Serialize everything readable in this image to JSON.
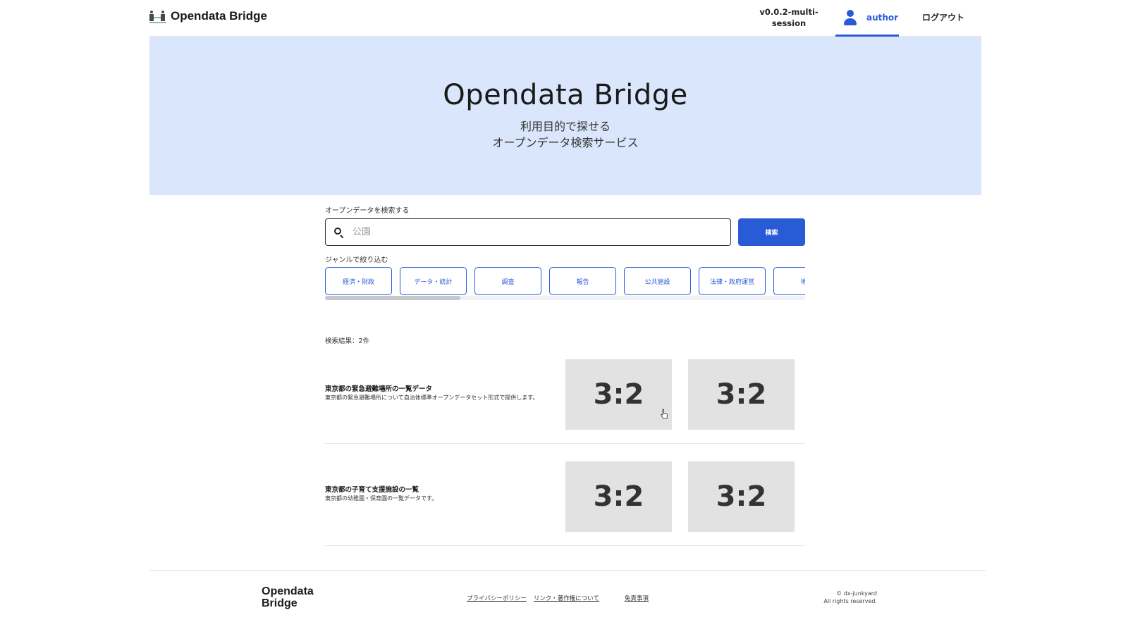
{
  "header": {
    "brand": "Opendata Bridge",
    "version_line1": "v0.0.2-multi-",
    "version_line2": "session",
    "user_name": "author",
    "logout_label": "ログアウト"
  },
  "hero": {
    "title": "Opendata Bridge",
    "subtitle_line1": "利用目的で探せる",
    "subtitle_line2": "オープンデータ検索サービス"
  },
  "search": {
    "label": "オープンデータを検索する",
    "placeholder": "公園",
    "value": "",
    "button_label": "検索"
  },
  "genre": {
    "label": "ジャンルで絞り込む",
    "chips": [
      "経済・財政",
      "データ・統計",
      "調査",
      "報告",
      "公共施設",
      "法律・政府運営",
      "地域"
    ]
  },
  "results": {
    "count_label": "検索結果：2件",
    "items": [
      {
        "title": "東京都の緊急避難場所の一覧データ",
        "description": "東京都の緊急避難場所について自治体標準オープンデータセット形式で提供します。",
        "thumb1": "3:2",
        "thumb2": "3:2"
      },
      {
        "title": "東京都の子育て支援施設の一覧",
        "description": "東京都の幼稚園・保育園の一覧データです。",
        "thumb1": "3:2",
        "thumb2": "3:2"
      }
    ]
  },
  "footer": {
    "brand_line1": "Opendata",
    "brand_line2": "Bridge",
    "links": [
      "プライバシーポリシー",
      "リンク・著作権について",
      "免責事項"
    ],
    "copyright_line1": "© dx-junkyard",
    "copyright_line2": "All rights reserved."
  },
  "colors": {
    "accent": "#2a5bd7",
    "hero_bg": "#d9e6fb",
    "thumb_bg": "#e2e2e2"
  }
}
